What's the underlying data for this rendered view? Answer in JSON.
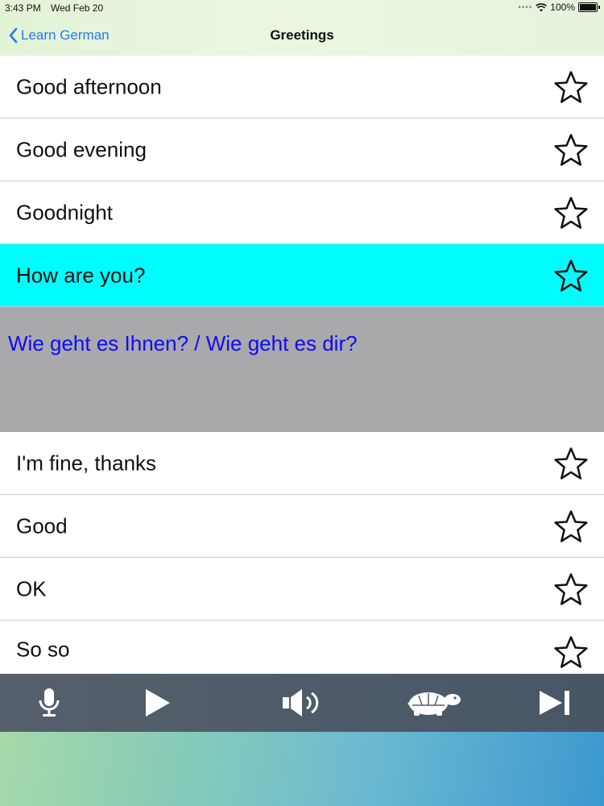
{
  "status_bar": {
    "time": "3:43 PM",
    "date": "Wed Feb 20",
    "battery": "100%"
  },
  "nav": {
    "back_label": "Learn German",
    "title": "Greetings"
  },
  "phrases_top": [
    {
      "label": "Good afternoon"
    },
    {
      "label": "Good evening"
    },
    {
      "label": "Goodnight"
    },
    {
      "label": "How are you?",
      "selected": true
    }
  ],
  "translation": {
    "text": "Wie geht es Ihnen? / Wie geht es dir?",
    "color": "#0d0df5"
  },
  "phrases_bottom": [
    {
      "label": "I'm fine, thanks"
    },
    {
      "label": "Good"
    },
    {
      "label": "OK"
    },
    {
      "label": "So so"
    }
  ],
  "toolbar": {
    "buttons": [
      "microphone-icon",
      "play-icon",
      "speaker-icon",
      "turtle-icon",
      "skip-forward-icon"
    ]
  },
  "colors": {
    "accent": "#1f7bf2",
    "selected_row": "#00fdfd",
    "translation_bg": "#a9a8ab",
    "toolbar_bg": "#525e6b"
  }
}
